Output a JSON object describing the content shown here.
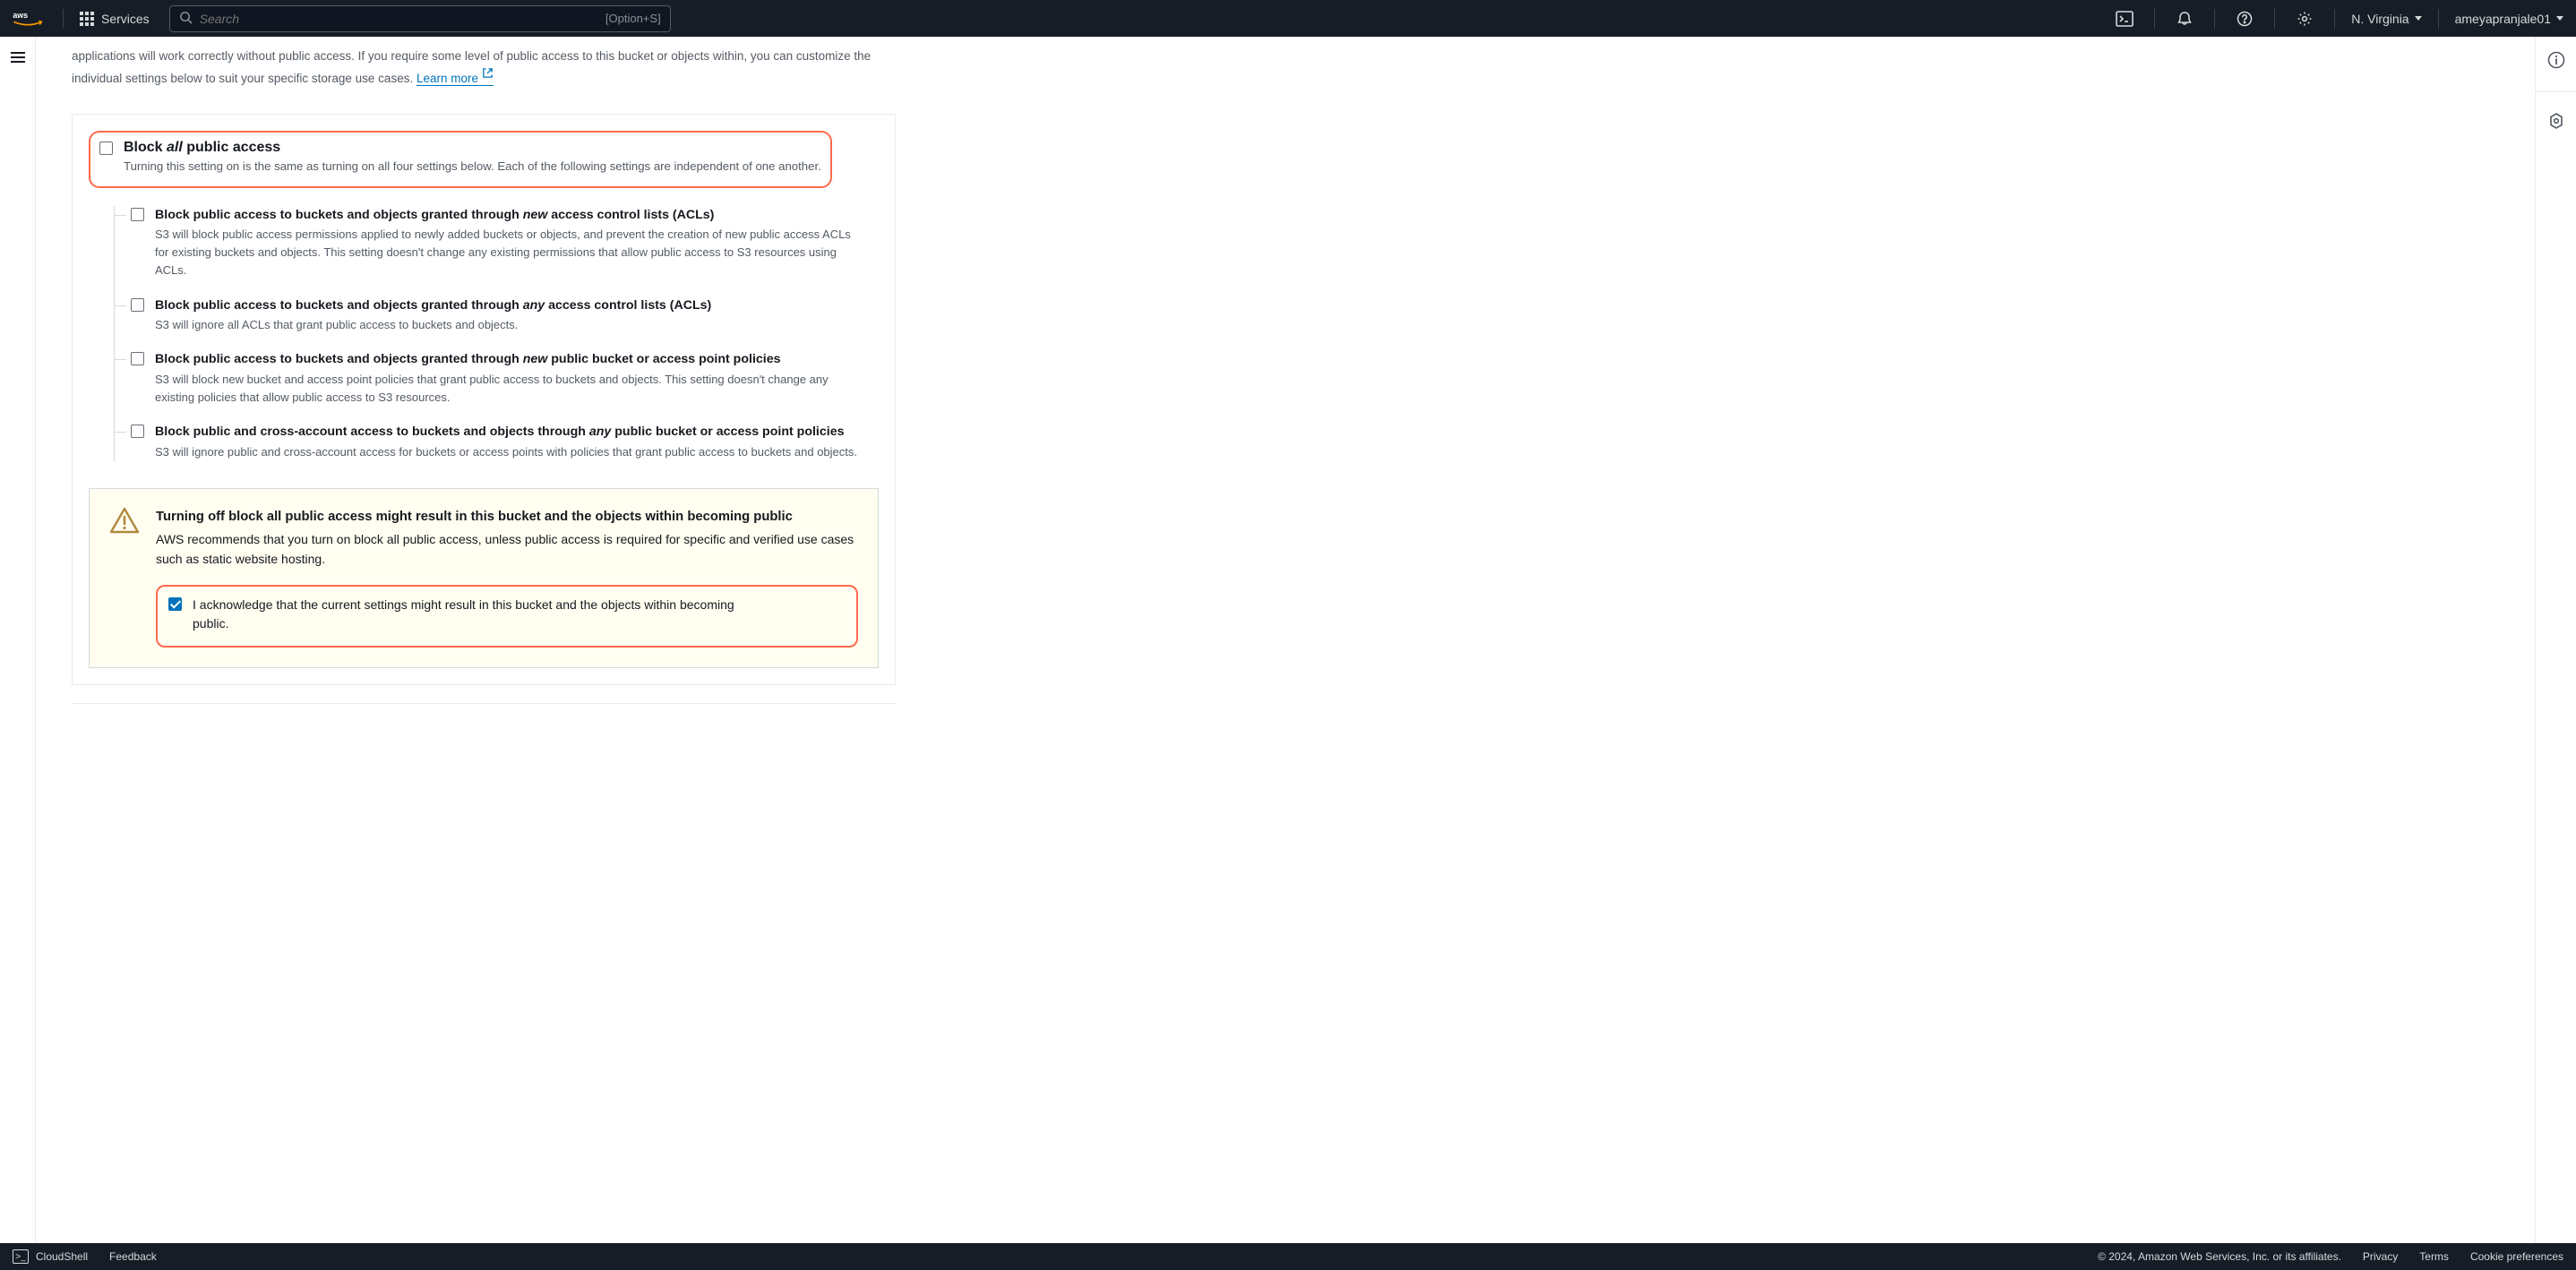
{
  "nav": {
    "services_label": "Services",
    "search_placeholder": "Search",
    "search_shortcut": "[Option+S]",
    "region_label": "N. Virginia",
    "user_label": "ameyapranjale01"
  },
  "intro": {
    "text": "applications will work correctly without public access. If you require some level of public access to this bucket or objects within, you can customize the individual settings below to suit your specific storage use cases. ",
    "learn_more": "Learn more"
  },
  "block_all": {
    "title_pre": "Block ",
    "title_ital": "all",
    "title_post": " public access",
    "desc": "Turning this setting on is the same as turning on all four settings below. Each of the following settings are independent of one another."
  },
  "subs": [
    {
      "t_pre": "Block public access to buckets and objects granted through ",
      "t_ital": "new",
      "t_post": " access control lists (ACLs)",
      "desc": "S3 will block public access permissions applied to newly added buckets or objects, and prevent the creation of new public access ACLs for existing buckets and objects. This setting doesn't change any existing permissions that allow public access to S3 resources using ACLs."
    },
    {
      "t_pre": "Block public access to buckets and objects granted through ",
      "t_ital": "any",
      "t_post": " access control lists (ACLs)",
      "desc": "S3 will ignore all ACLs that grant public access to buckets and objects."
    },
    {
      "t_pre": "Block public access to buckets and objects granted through ",
      "t_ital": "new",
      "t_post": " public bucket or access point policies",
      "desc": "S3 will block new bucket and access point policies that grant public access to buckets and objects. This setting doesn't change any existing policies that allow public access to S3 resources."
    },
    {
      "t_pre": "Block public and cross-account access to buckets and objects through ",
      "t_ital": "any",
      "t_post": " public bucket or access point policies",
      "desc": "S3 will ignore public and cross-account access for buckets or access points with policies that grant public access to buckets and objects."
    }
  ],
  "warning": {
    "title": "Turning off block all public access might result in this bucket and the objects within becoming public",
    "text": "AWS recommends that you turn on block all public access, unless public access is required for specific and verified use cases such as static website hosting.",
    "ack": "I acknowledge that the current settings might result in this bucket and the objects within becoming public."
  },
  "footer": {
    "cloudshell": "CloudShell",
    "feedback": "Feedback",
    "copyright": "© 2024, Amazon Web Services, Inc. or its affiliates.",
    "privacy": "Privacy",
    "terms": "Terms",
    "cookies": "Cookie preferences"
  }
}
